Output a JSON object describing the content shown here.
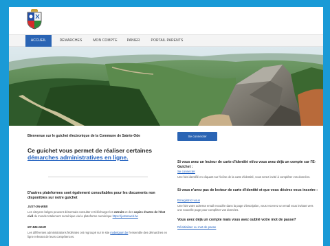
{
  "nav": {
    "items": [
      {
        "label": "Accueil",
        "active": true
      },
      {
        "label": "Démarches",
        "active": false
      },
      {
        "label": "Mon compte",
        "active": false
      },
      {
        "label": "Panier",
        "active": false
      },
      {
        "label": "Portail parents",
        "active": false
      }
    ]
  },
  "left": {
    "welcome": "Bienvenue sur le guichet électronique de la Commune de Sainte-Ode",
    "intro_prefix": "Ce guichet vous permet de réaliser certaines ",
    "intro_link": "démarches administratives en ligne.",
    "platforms_heading": "D'autres plateformes sont également consultables pour les documents non disponibles sur notre guichet",
    "just_label": "JUST-ON-WEB",
    "just_text_1": "Les citoyens belges peuvent désormais consulter et télécharger les ",
    "just_bold_1": "extraits",
    "just_text_2": " et des ",
    "just_bold_2": "copies d'actes de l'état civil",
    "just_text_3": " du monde totalement numérique via la plateforme numérique ",
    "just_link": "https://justonweb.be",
    "mybel_label": "MY BELGIUM",
    "mybel_text_1": "Les différentes administrations fédérales ont regroupé sur le site ",
    "mybel_link": "mybelgium.be",
    "mybel_text_2": " l'ensemble des démarches en ligne relevant de leurs compétences."
  },
  "right": {
    "login_button": "Se connecter",
    "q1_heading": "Si vous avez un lecteur de carte d'identité et/ou vous avez déjà un compte sur l'E-Guichet :",
    "q1_link": "Se connecter",
    "q1_body": "Une fois identifié en cliquant sur l'icône de la carte d'identité, vous serez invité à compléter vos données.",
    "q2_heading": "Si vous n'avez pas de lecteur de carte d'identité et que vous désirez vous inscrire :",
    "q2_link": "Enregistrez-vous",
    "q2_body": "Une fois votre adresse email encodée dans la page d'inscription, vous recevrez un email vous invitant vers une nouvelle page pour compléter vos données.",
    "q3_heading": "Vous avez déjà un compte mais vous avez oublié votre mot de passe?",
    "q3_link": "Réinitialiser ou mot de passe"
  }
}
